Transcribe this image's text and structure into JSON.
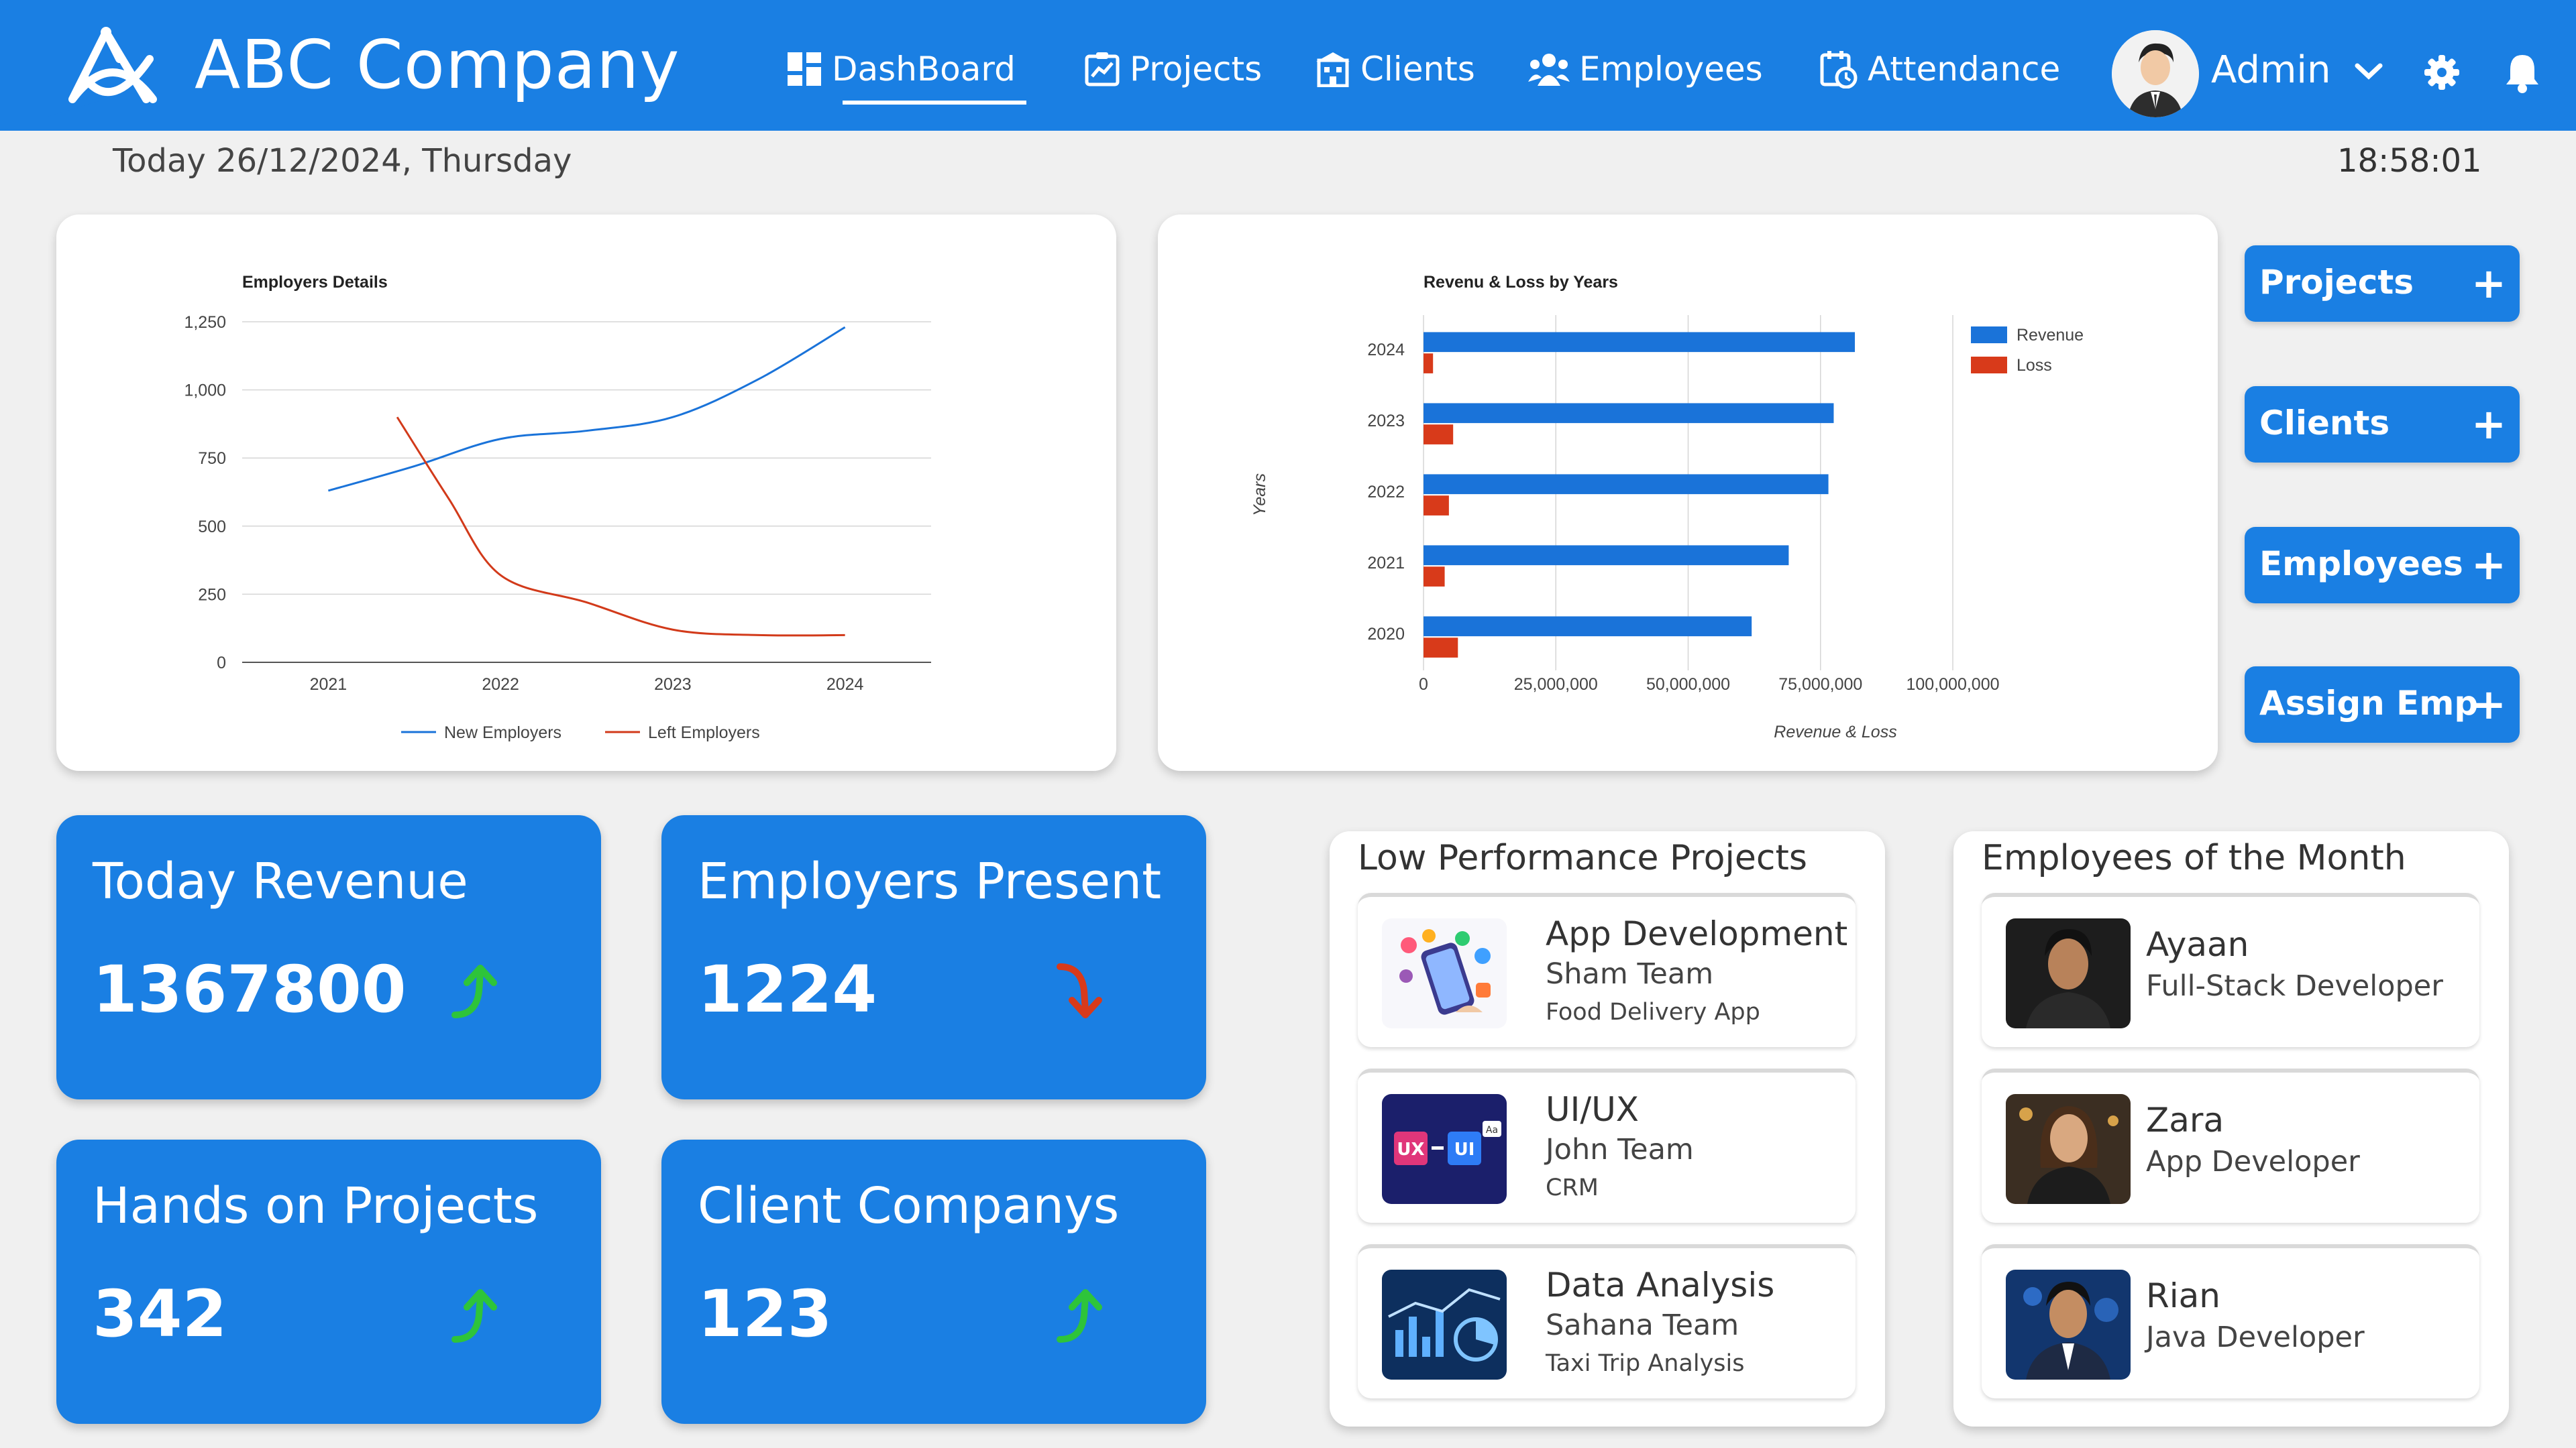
{
  "app": {
    "name": "ABC Company"
  },
  "nav": [
    {
      "label": "DashBoard",
      "icon": "dashboard-icon",
      "active": true
    },
    {
      "label": "Projects",
      "icon": "projects-icon"
    },
    {
      "label": "Clients",
      "icon": "clients-icon"
    },
    {
      "label": "Employees",
      "icon": "employees-icon"
    },
    {
      "label": "Attendance",
      "icon": "attendance-icon"
    }
  ],
  "user": {
    "name": "Admin"
  },
  "date_text": "Today 26/12/2024, Thursday",
  "clock": "18:58:01",
  "chart_data": [
    {
      "type": "line",
      "title": "Employers Details",
      "x_ticks": [
        "2021",
        "2022",
        "2023",
        "2024"
      ],
      "y_ticks": [
        "0",
        "250",
        "500",
        "750",
        "1,000",
        "1,250"
      ],
      "ylim": [
        0,
        1250
      ],
      "series": [
        {
          "name": "New Employers",
          "color": "#1a73d9",
          "points": [
            [
              2021,
              630
            ],
            [
              2021.5,
              720
            ],
            [
              2022,
              820
            ],
            [
              2022.5,
              850
            ],
            [
              2023,
              900
            ],
            [
              2023.5,
              1040
            ],
            [
              2024,
              1230
            ]
          ]
        },
        {
          "name": "Left Employers",
          "color": "#d23a1a",
          "points": [
            [
              2021.4,
              900
            ],
            [
              2021.7,
              600
            ],
            [
              2022,
              320
            ],
            [
              2022.5,
              220
            ],
            [
              2023,
              120
            ],
            [
              2023.5,
              100
            ],
            [
              2024,
              100
            ]
          ]
        }
      ],
      "legend": "bottom"
    },
    {
      "type": "bar",
      "orientation": "horizontal",
      "title": "Revenu & Loss by Years",
      "ylabel": "Years",
      "xlabel": "Revenue & Loss",
      "categories": [
        "2024",
        "2023",
        "2022",
        "2021",
        "2020"
      ],
      "x_ticks": [
        "0",
        "25,000,000",
        "50,000,000",
        "75,000,000",
        "100,000,000"
      ],
      "xlim": [
        0,
        100000000
      ],
      "series": [
        {
          "name": "Revenue",
          "color": "#1a73d9",
          "values": [
            81500000,
            77500000,
            76500000,
            69000000,
            62000000
          ]
        },
        {
          "name": "Loss",
          "color": "#d83a1a",
          "values": [
            1800000,
            5600000,
            4800000,
            4000000,
            6500000
          ]
        }
      ],
      "legend": "top-right"
    }
  ],
  "side_buttons": [
    {
      "label": "Projects",
      "icon": "plus-icon"
    },
    {
      "label": "Clients",
      "icon": "plus-icon"
    },
    {
      "label": "Employees",
      "icon": "plus-icon"
    },
    {
      "label": "Assign Emp",
      "icon": "plus-icon"
    }
  ],
  "stats": [
    {
      "title": "Today Revenue",
      "value": "1367800",
      "trend": "up",
      "trend_color": "#2ec43a"
    },
    {
      "title": "Employers Present",
      "value": "1224",
      "trend": "down",
      "trend_color": "#d83a1a"
    },
    {
      "title": "Hands on Projects",
      "value": "342",
      "trend": "up",
      "trend_color": "#2ec43a"
    },
    {
      "title": "Client Companys",
      "value": "123",
      "trend": "up",
      "trend_color": "#2ec43a"
    }
  ],
  "low_performance": {
    "title": "Low Performance Projects",
    "items": [
      {
        "name": "App Development",
        "team": "Sham Team",
        "desc": "Food Delivery App"
      },
      {
        "name": "UI/UX",
        "team": "John Team",
        "desc": "CRM"
      },
      {
        "name": "Data Analysis",
        "team": "Sahana Team",
        "desc": "Taxi Trip Analysis"
      }
    ]
  },
  "employees_month": {
    "title": "Employees of the Month",
    "items": [
      {
        "name": "Ayaan",
        "role": "Full-Stack Developer"
      },
      {
        "name": "Zara",
        "role": "App Developer"
      },
      {
        "name": "Rian",
        "role": "Java Developer"
      }
    ]
  },
  "colors": {
    "primary": "#1a7fe3",
    "up": "#2ec43a",
    "down": "#d83a1a"
  }
}
